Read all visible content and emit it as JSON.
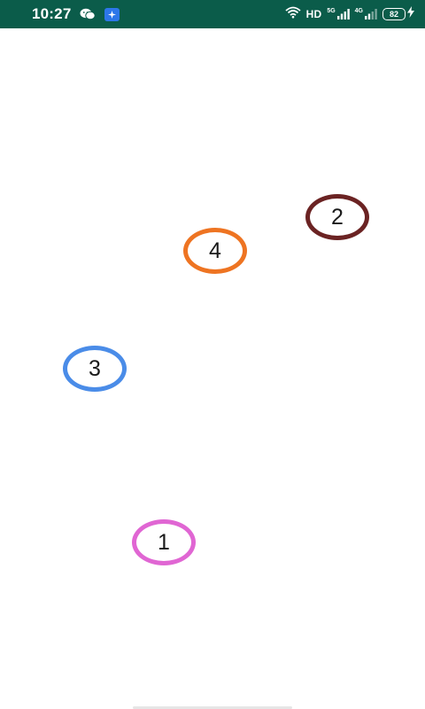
{
  "status_bar": {
    "time": "10:27",
    "network_label": "HD",
    "signal_1_tag": "5G",
    "signal_2_tag": "4G",
    "battery_level": "82",
    "background_color": "#0b5c4a"
  },
  "markers": [
    {
      "label": "1",
      "color": "#e066d3"
    },
    {
      "label": "2",
      "color": "#6b2323"
    },
    {
      "label": "3",
      "color": "#4a8ce8"
    },
    {
      "label": "4",
      "color": "#ee7422"
    }
  ]
}
